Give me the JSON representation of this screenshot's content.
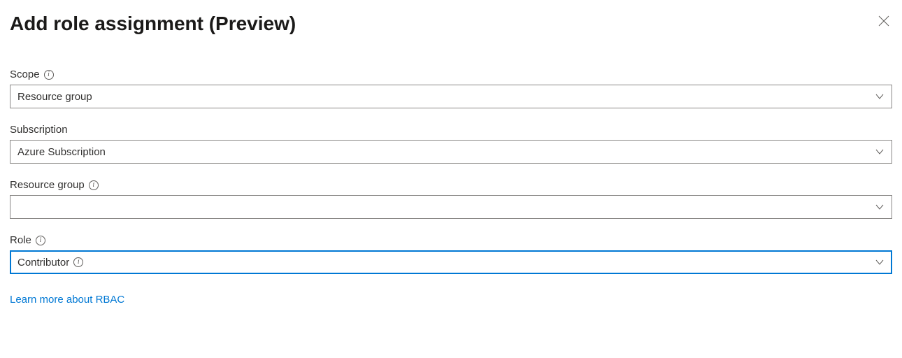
{
  "header": {
    "title": "Add role assignment (Preview)"
  },
  "fields": {
    "scope": {
      "label": "Scope",
      "value": "Resource group",
      "has_info": true
    },
    "subscription": {
      "label": "Subscription",
      "value": "Azure Subscription",
      "has_info": false
    },
    "resource_group": {
      "label": "Resource group",
      "value": "",
      "has_info": true
    },
    "role": {
      "label": "Role",
      "value": "Contributor",
      "has_info": true,
      "value_has_info": true,
      "focused": true
    }
  },
  "link": {
    "text": "Learn more about RBAC"
  },
  "colors": {
    "accent": "#0078d4",
    "border": "#8a8886",
    "text": "#323130"
  }
}
